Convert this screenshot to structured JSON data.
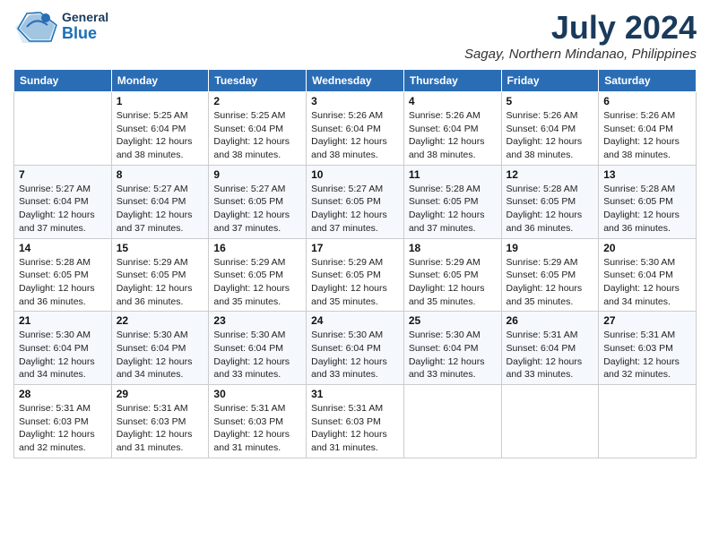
{
  "header": {
    "logo_general": "General",
    "logo_blue": "Blue",
    "title": "July 2024",
    "subtitle": "Sagay, Northern Mindanao, Philippines"
  },
  "calendar": {
    "days_of_week": [
      "Sunday",
      "Monday",
      "Tuesday",
      "Wednesday",
      "Thursday",
      "Friday",
      "Saturday"
    ],
    "weeks": [
      [
        {
          "day": "",
          "info": ""
        },
        {
          "day": "1",
          "info": "Sunrise: 5:25 AM\nSunset: 6:04 PM\nDaylight: 12 hours\nand 38 minutes."
        },
        {
          "day": "2",
          "info": "Sunrise: 5:25 AM\nSunset: 6:04 PM\nDaylight: 12 hours\nand 38 minutes."
        },
        {
          "day": "3",
          "info": "Sunrise: 5:26 AM\nSunset: 6:04 PM\nDaylight: 12 hours\nand 38 minutes."
        },
        {
          "day": "4",
          "info": "Sunrise: 5:26 AM\nSunset: 6:04 PM\nDaylight: 12 hours\nand 38 minutes."
        },
        {
          "day": "5",
          "info": "Sunrise: 5:26 AM\nSunset: 6:04 PM\nDaylight: 12 hours\nand 38 minutes."
        },
        {
          "day": "6",
          "info": "Sunrise: 5:26 AM\nSunset: 6:04 PM\nDaylight: 12 hours\nand 38 minutes."
        }
      ],
      [
        {
          "day": "7",
          "info": "Sunrise: 5:27 AM\nSunset: 6:04 PM\nDaylight: 12 hours\nand 37 minutes."
        },
        {
          "day": "8",
          "info": "Sunrise: 5:27 AM\nSunset: 6:04 PM\nDaylight: 12 hours\nand 37 minutes."
        },
        {
          "day": "9",
          "info": "Sunrise: 5:27 AM\nSunset: 6:05 PM\nDaylight: 12 hours\nand 37 minutes."
        },
        {
          "day": "10",
          "info": "Sunrise: 5:27 AM\nSunset: 6:05 PM\nDaylight: 12 hours\nand 37 minutes."
        },
        {
          "day": "11",
          "info": "Sunrise: 5:28 AM\nSunset: 6:05 PM\nDaylight: 12 hours\nand 37 minutes."
        },
        {
          "day": "12",
          "info": "Sunrise: 5:28 AM\nSunset: 6:05 PM\nDaylight: 12 hours\nand 36 minutes."
        },
        {
          "day": "13",
          "info": "Sunrise: 5:28 AM\nSunset: 6:05 PM\nDaylight: 12 hours\nand 36 minutes."
        }
      ],
      [
        {
          "day": "14",
          "info": "Sunrise: 5:28 AM\nSunset: 6:05 PM\nDaylight: 12 hours\nand 36 minutes."
        },
        {
          "day": "15",
          "info": "Sunrise: 5:29 AM\nSunset: 6:05 PM\nDaylight: 12 hours\nand 36 minutes."
        },
        {
          "day": "16",
          "info": "Sunrise: 5:29 AM\nSunset: 6:05 PM\nDaylight: 12 hours\nand 35 minutes."
        },
        {
          "day": "17",
          "info": "Sunrise: 5:29 AM\nSunset: 6:05 PM\nDaylight: 12 hours\nand 35 minutes."
        },
        {
          "day": "18",
          "info": "Sunrise: 5:29 AM\nSunset: 6:05 PM\nDaylight: 12 hours\nand 35 minutes."
        },
        {
          "day": "19",
          "info": "Sunrise: 5:29 AM\nSunset: 6:05 PM\nDaylight: 12 hours\nand 35 minutes."
        },
        {
          "day": "20",
          "info": "Sunrise: 5:30 AM\nSunset: 6:04 PM\nDaylight: 12 hours\nand 34 minutes."
        }
      ],
      [
        {
          "day": "21",
          "info": "Sunrise: 5:30 AM\nSunset: 6:04 PM\nDaylight: 12 hours\nand 34 minutes."
        },
        {
          "day": "22",
          "info": "Sunrise: 5:30 AM\nSunset: 6:04 PM\nDaylight: 12 hours\nand 34 minutes."
        },
        {
          "day": "23",
          "info": "Sunrise: 5:30 AM\nSunset: 6:04 PM\nDaylight: 12 hours\nand 33 minutes."
        },
        {
          "day": "24",
          "info": "Sunrise: 5:30 AM\nSunset: 6:04 PM\nDaylight: 12 hours\nand 33 minutes."
        },
        {
          "day": "25",
          "info": "Sunrise: 5:30 AM\nSunset: 6:04 PM\nDaylight: 12 hours\nand 33 minutes."
        },
        {
          "day": "26",
          "info": "Sunrise: 5:31 AM\nSunset: 6:04 PM\nDaylight: 12 hours\nand 33 minutes."
        },
        {
          "day": "27",
          "info": "Sunrise: 5:31 AM\nSunset: 6:03 PM\nDaylight: 12 hours\nand 32 minutes."
        }
      ],
      [
        {
          "day": "28",
          "info": "Sunrise: 5:31 AM\nSunset: 6:03 PM\nDaylight: 12 hours\nand 32 minutes."
        },
        {
          "day": "29",
          "info": "Sunrise: 5:31 AM\nSunset: 6:03 PM\nDaylight: 12 hours\nand 31 minutes."
        },
        {
          "day": "30",
          "info": "Sunrise: 5:31 AM\nSunset: 6:03 PM\nDaylight: 12 hours\nand 31 minutes."
        },
        {
          "day": "31",
          "info": "Sunrise: 5:31 AM\nSunset: 6:03 PM\nDaylight: 12 hours\nand 31 minutes."
        },
        {
          "day": "",
          "info": ""
        },
        {
          "day": "",
          "info": ""
        },
        {
          "day": "",
          "info": ""
        }
      ]
    ]
  }
}
